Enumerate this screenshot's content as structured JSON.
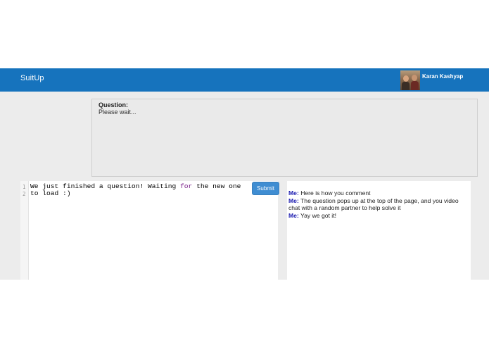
{
  "navbar": {
    "brand": "SuitUp",
    "user_name": "Karan Kashyap"
  },
  "question": {
    "label": "Question:",
    "text": "Please wait..."
  },
  "editor": {
    "line_numbers": [
      "1",
      "2"
    ],
    "line1_before": "We just finished a question! Waiting ",
    "line1_keyword": "for",
    "line1_after": " the new one",
    "line2": "to load :)",
    "submit_label": "Submit"
  },
  "chat": {
    "messages": [
      {
        "author": "Me:",
        "text": " Here is how you comment"
      },
      {
        "author": "Me:",
        "text": " The question pops up at the top of the page, and you video chat with a random partner to help solve it"
      },
      {
        "author": "Me:",
        "text": " Yay we got it!"
      }
    ]
  },
  "colors": {
    "navbar": "#1673bd",
    "background": "#ececec",
    "submit_button": "#3f8dd2",
    "chat_author": "#1b1bb0",
    "keyword": "#7a1f8a"
  },
  "icons": {
    "avatar": "user-avatar-photo"
  }
}
